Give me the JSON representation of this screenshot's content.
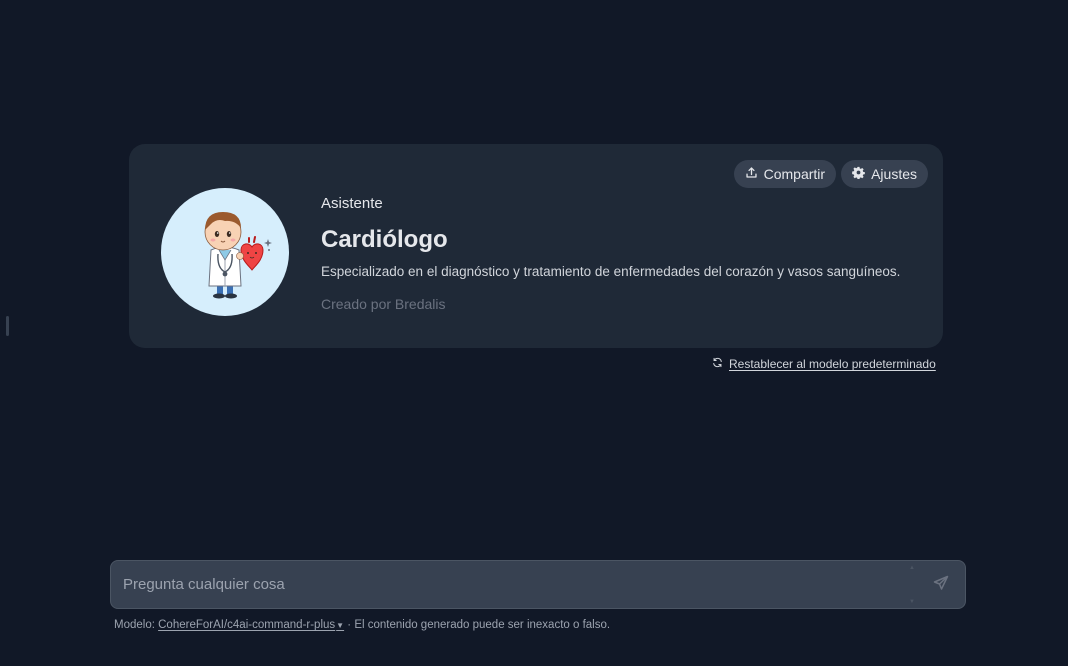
{
  "assistant": {
    "kicker": "Asistente",
    "name": "Cardiólogo",
    "description": "Especializado en el diagnóstico y tratamiento de enfermedades del corazón y vasos sanguíneos.",
    "author": "Creado por Bredalis",
    "avatar_icon": "doctor-holding-heart-illustration"
  },
  "actions": {
    "share_label": "Compartir",
    "share_icon": "share-upload-icon",
    "settings_label": "Ajustes",
    "settings_icon": "gear-icon"
  },
  "reset": {
    "label": "Restablecer al modelo predeterminado",
    "icon": "refresh-icon"
  },
  "chat": {
    "placeholder": "Pregunta cualquier cosa",
    "send_icon": "send-icon"
  },
  "footer": {
    "model_prefix": "Modelo:",
    "model_name": "CohereForAI/c4ai-command-r-plus",
    "disclaimer": "· El contenido generado puede ser inexacto o falso."
  },
  "colors": {
    "background": "#111827",
    "card": "#1f2937",
    "pill": "#374151",
    "avatar_bg": "#d6eefc"
  }
}
